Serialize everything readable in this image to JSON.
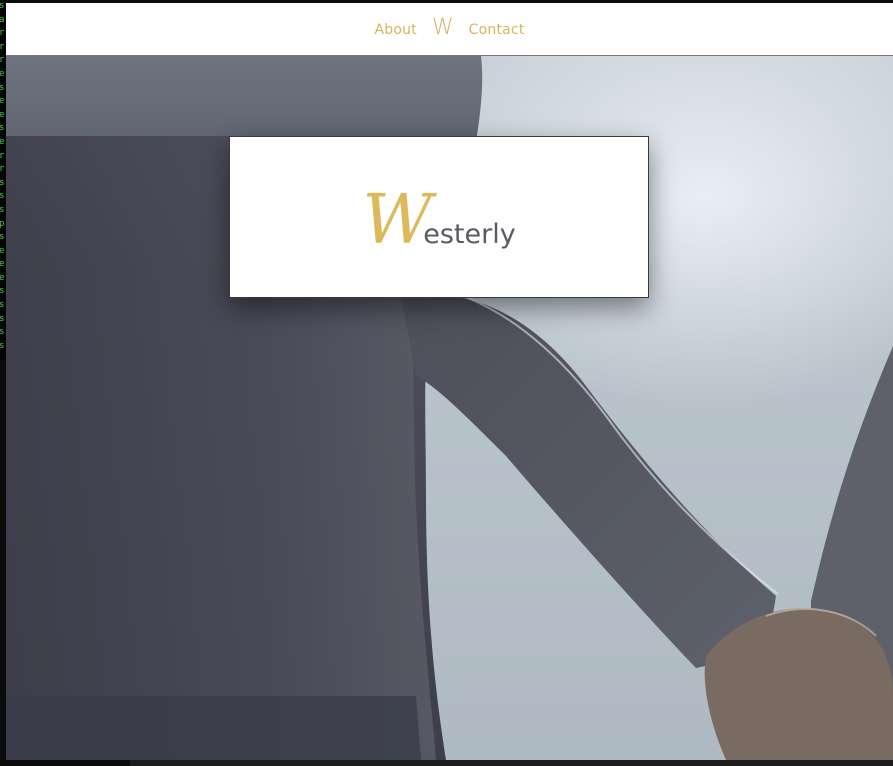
{
  "nav": {
    "about_label": "About",
    "logo_mark": "W",
    "contact_label": "Contact"
  },
  "brand": {
    "initial": "W",
    "rest": "esterly"
  },
  "terminal": {
    "lines": [
      "s",
      "a",
      "r",
      "r",
      "r",
      "e",
      "s",
      "e",
      "e",
      "s",
      "e",
      "r",
      "r",
      "s",
      "s",
      "s",
      "p",
      "s",
      "e",
      "e",
      "e",
      "s",
      "s",
      "s",
      "s",
      "s"
    ]
  },
  "colors": {
    "accent": "#d8b25d",
    "logo_gold": "#dcb95a",
    "logo_gray": "#5a5a64"
  }
}
